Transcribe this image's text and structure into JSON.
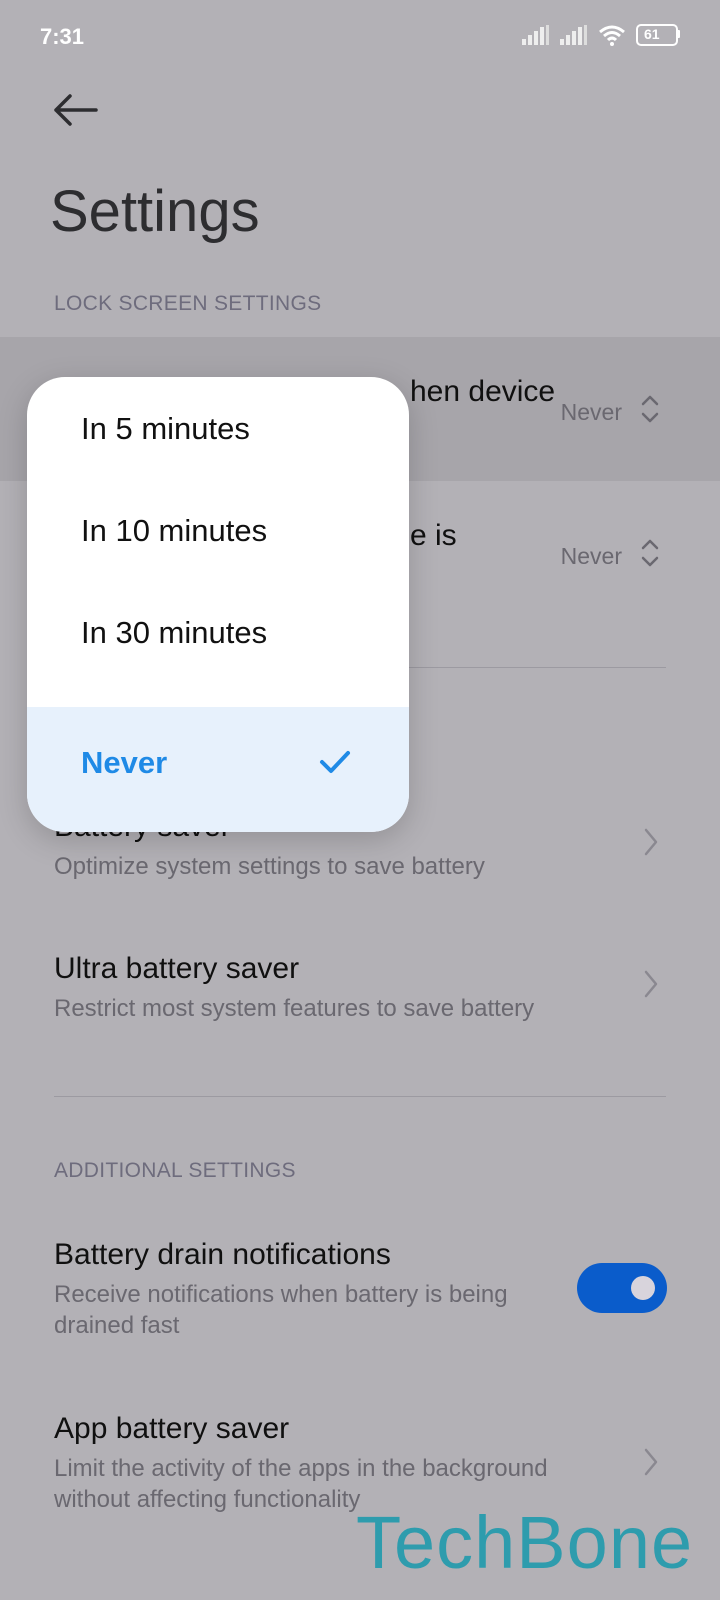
{
  "status_bar": {
    "time": "7:31",
    "battery": "61"
  },
  "header": {
    "title": "Settings"
  },
  "sections": {
    "lock_screen": "LOCK SCREEN SETTINGS",
    "additional": "ADDITIONAL SETTINGS"
  },
  "rows": {
    "lock_row_1": {
      "title_fragment": "hen device",
      "value": "Never"
    },
    "lock_row_2": {
      "title_fragment": "e is",
      "value": "Never"
    },
    "battery_saver": {
      "title": "Battery saver",
      "subtitle": "Optimize system settings to save battery"
    },
    "ultra_battery_saver": {
      "title": "Ultra battery saver",
      "subtitle": "Restrict most system features to save battery"
    },
    "battery_drain": {
      "title": "Battery drain notifications",
      "subtitle": "Receive notifications when battery is being drained fast",
      "enabled": true
    },
    "app_battery_saver": {
      "title": "App battery saver",
      "subtitle": "Limit the activity of the apps in the background without affecting functionality"
    }
  },
  "popup": {
    "options": [
      "In 5 minutes",
      "In 10 minutes",
      "In 30 minutes",
      "Never"
    ],
    "selected": "Never"
  },
  "watermark": "TechBone",
  "colors": {
    "accent": "#1f8ae6",
    "toggle_on": "#0a5ccb",
    "watermark": "#2e9cad"
  }
}
